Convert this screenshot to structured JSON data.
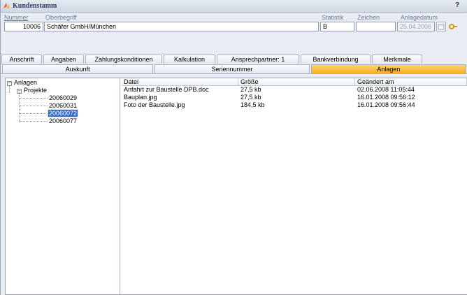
{
  "window": {
    "title": "Kundenstamm",
    "help": "?"
  },
  "header": {
    "nummer_label": "Nummer",
    "nummer_value": "10006",
    "oberbegriff_label": "Oberbegriff",
    "oberbegriff_value": "Schäfer GmbH/München",
    "statistik_label": "Statistik",
    "statistik_value": "B",
    "zeichen_label": "Zeichen",
    "zeichen_value": "",
    "anlagedatum_label": "Anlagedatum",
    "anlagedatum_value": "25.04.2006"
  },
  "tabs_row1": [
    "Anschrift",
    "Angaben",
    "Zahlungskonditionen",
    "Kalkulation",
    "Ansprechpartner: 1",
    "Bankverbindung",
    "Merkmale"
  ],
  "tabs_row2": [
    "Auskunft",
    "Seriennummer",
    "Anlagen"
  ],
  "active_tab": "Anlagen",
  "tree": {
    "root": "Anlagen",
    "folder": "Projekte",
    "items": [
      "20060029",
      "20060031",
      "20060072",
      "20060077"
    ],
    "selected": "20060072"
  },
  "list": {
    "columns": [
      "Datei",
      "Größe",
      "Geändert am"
    ],
    "rows": [
      [
        "Anfahrt zur Baustelle DPB.doc",
        "27,5 kb",
        "02.06.2008 11:05:44"
      ],
      [
        "Bauplan.jpg",
        "27,5 kb",
        "16.01.2008 09:56:12"
      ],
      [
        "Foto der Baustelle.jpg",
        "184,5 kb",
        "16.01.2008 09:56:44"
      ]
    ]
  },
  "colors": {
    "active_tab": "#f7ae22",
    "selection": "#316ac5",
    "title": "#2d3e63"
  }
}
